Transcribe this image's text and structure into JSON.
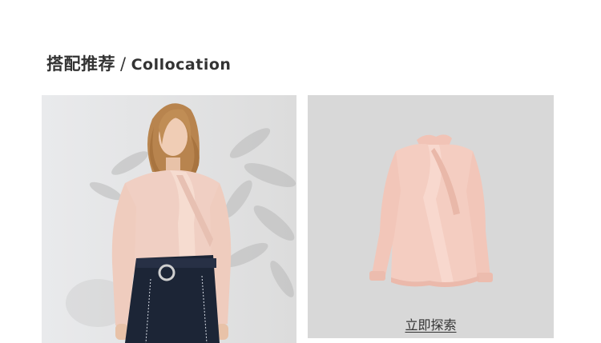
{
  "section": {
    "title_cn": "搭配推荐",
    "separator": "/",
    "title_en": "Collocation"
  },
  "model_photo": {
    "icon": "model-wearing-blouse-photo",
    "background_color": "#e6e6e6",
    "blouse_color": "#f0cfc3",
    "skirt_color": "#1c2536"
  },
  "product": {
    "icon": "pink-blouse-product-photo",
    "background_color": "#d8d8d8",
    "blouse_color": "#f2c9bd",
    "explore_label": "立即探索"
  }
}
